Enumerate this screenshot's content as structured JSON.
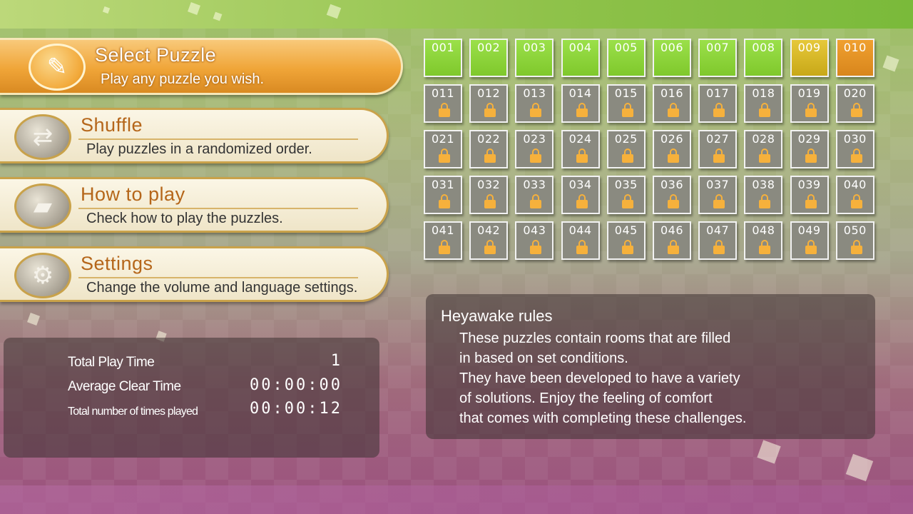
{
  "menu": {
    "items": [
      {
        "title": "Select Puzzle",
        "desc": "Play any puzzle you wish.",
        "icon": "pencil-icon"
      },
      {
        "title": "Shuffle",
        "desc": "Play puzzles in a randomized order.",
        "icon": "shuffle-icon"
      },
      {
        "title": "How to play",
        "desc": "Check how to play the puzzles.",
        "icon": "book-icon"
      },
      {
        "title": "Settings",
        "desc": "Change the volume and language settings.",
        "icon": "gear-icon"
      }
    ]
  },
  "stats": {
    "rows": [
      {
        "label": "Total Play Time",
        "value": "1"
      },
      {
        "label": "Average Clear Time",
        "value": "00:00:00"
      },
      {
        "label": "Total number of times played",
        "value": "00:00:12"
      }
    ]
  },
  "puzzles": {
    "tiles": [
      {
        "num": "001",
        "state": "cleared"
      },
      {
        "num": "002",
        "state": "cleared"
      },
      {
        "num": "003",
        "state": "cleared"
      },
      {
        "num": "004",
        "state": "cleared"
      },
      {
        "num": "005",
        "state": "cleared"
      },
      {
        "num": "006",
        "state": "cleared"
      },
      {
        "num": "007",
        "state": "cleared"
      },
      {
        "num": "008",
        "state": "cleared"
      },
      {
        "num": "009",
        "state": "partial"
      },
      {
        "num": "010",
        "state": "current"
      },
      {
        "num": "011",
        "state": "locked"
      },
      {
        "num": "012",
        "state": "locked"
      },
      {
        "num": "013",
        "state": "locked"
      },
      {
        "num": "014",
        "state": "locked"
      },
      {
        "num": "015",
        "state": "locked"
      },
      {
        "num": "016",
        "state": "locked"
      },
      {
        "num": "017",
        "state": "locked"
      },
      {
        "num": "018",
        "state": "locked"
      },
      {
        "num": "019",
        "state": "locked"
      },
      {
        "num": "020",
        "state": "locked"
      },
      {
        "num": "021",
        "state": "locked"
      },
      {
        "num": "022",
        "state": "locked"
      },
      {
        "num": "023",
        "state": "locked"
      },
      {
        "num": "024",
        "state": "locked"
      },
      {
        "num": "025",
        "state": "locked"
      },
      {
        "num": "026",
        "state": "locked"
      },
      {
        "num": "027",
        "state": "locked"
      },
      {
        "num": "028",
        "state": "locked"
      },
      {
        "num": "029",
        "state": "locked"
      },
      {
        "num": "030",
        "state": "locked"
      },
      {
        "num": "031",
        "state": "locked"
      },
      {
        "num": "032",
        "state": "locked"
      },
      {
        "num": "033",
        "state": "locked"
      },
      {
        "num": "034",
        "state": "locked"
      },
      {
        "num": "035",
        "state": "locked"
      },
      {
        "num": "036",
        "state": "locked"
      },
      {
        "num": "037",
        "state": "locked"
      },
      {
        "num": "038",
        "state": "locked"
      },
      {
        "num": "039",
        "state": "locked"
      },
      {
        "num": "040",
        "state": "locked"
      },
      {
        "num": "041",
        "state": "locked"
      },
      {
        "num": "042",
        "state": "locked"
      },
      {
        "num": "043",
        "state": "locked"
      },
      {
        "num": "044",
        "state": "locked"
      },
      {
        "num": "045",
        "state": "locked"
      },
      {
        "num": "046",
        "state": "locked"
      },
      {
        "num": "047",
        "state": "locked"
      },
      {
        "num": "048",
        "state": "locked"
      },
      {
        "num": "049",
        "state": "locked"
      },
      {
        "num": "050",
        "state": "locked"
      }
    ]
  },
  "rules": {
    "title": "Heyawake rules",
    "lines": [
      "These puzzles contain rooms that are filled",
      "in based on set conditions.",
      "They have been developed to have a variety",
      "of solutions. Enjoy the feeling of comfort",
      "that comes with completing these challenges."
    ]
  },
  "colors": {
    "selected_accent": "#f0a538",
    "cleared": "#8fd43a",
    "partial": "#d8b828",
    "current": "#e4931f",
    "locked": "#8a8a80",
    "lock": "#f6b13c"
  }
}
